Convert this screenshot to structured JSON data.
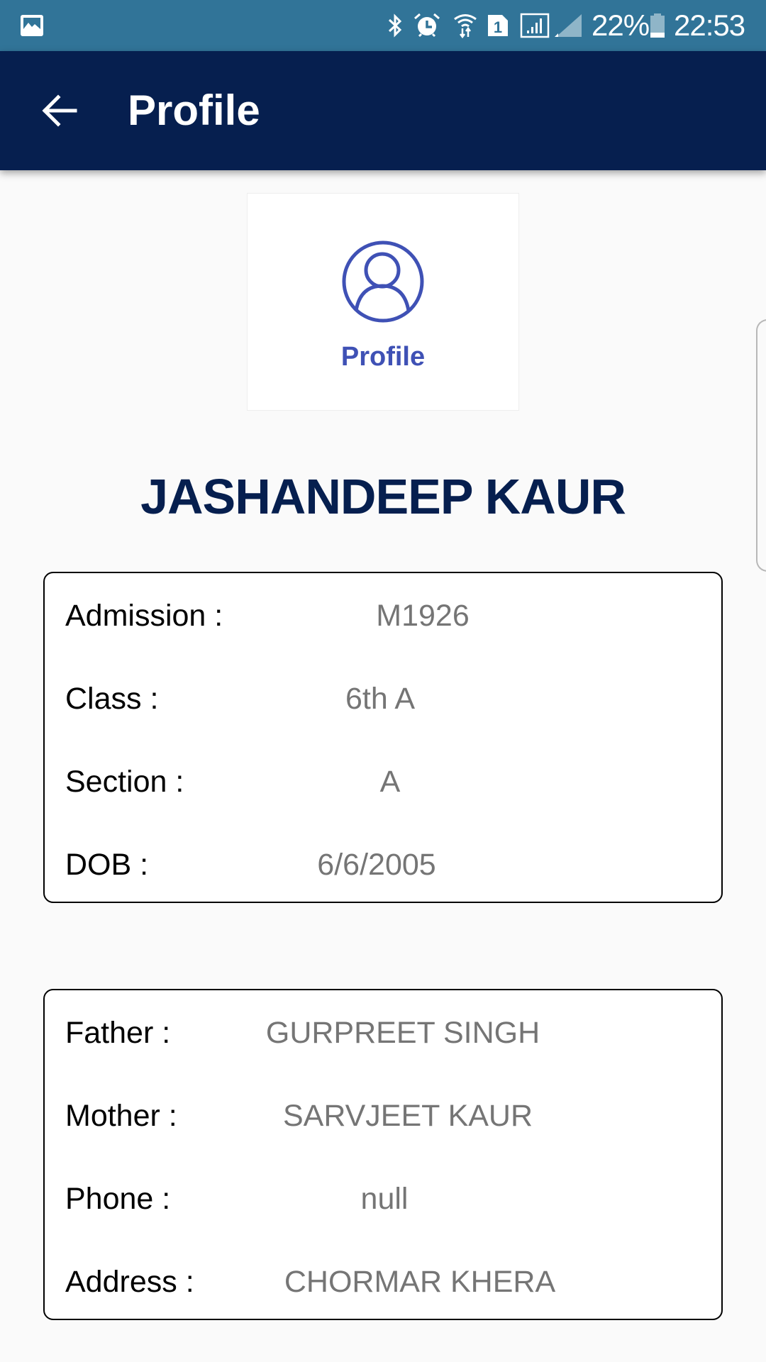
{
  "status_bar": {
    "icons": [
      "gallery-notification-icon",
      "bluetooth-icon",
      "alarm-icon",
      "wifi-data-icon",
      "sim-1-icon",
      "signal-sim1-icon",
      "signal-sim2-icon",
      "battery-icon"
    ],
    "battery_percent": "22%",
    "time": "22:53",
    "background_color": "#317498"
  },
  "toolbar": {
    "back_icon": "arrow-back-icon",
    "title": "Profile",
    "background_color": "#061f4f"
  },
  "profile_tile": {
    "icon": "account-circle-icon",
    "label": "Profile",
    "accent_color": "#3f51b5"
  },
  "student": {
    "name": "JASHANDEEP KAUR"
  },
  "academic_card": {
    "rows": [
      {
        "label": "Admission :",
        "value": "M1926"
      },
      {
        "label": "Class :",
        "value": "6th A"
      },
      {
        "label": "Section :",
        "value": "A"
      },
      {
        "label": "DOB :",
        "value": "6/6/2005"
      }
    ]
  },
  "family_card": {
    "rows": [
      {
        "label": "Father :",
        "value": "GURPREET SINGH"
      },
      {
        "label": "Mother :",
        "value": "SARVJEET KAUR"
      },
      {
        "label": "Phone :",
        "value": "null"
      },
      {
        "label": "Address :",
        "value": "CHORMAR KHERA"
      }
    ]
  }
}
